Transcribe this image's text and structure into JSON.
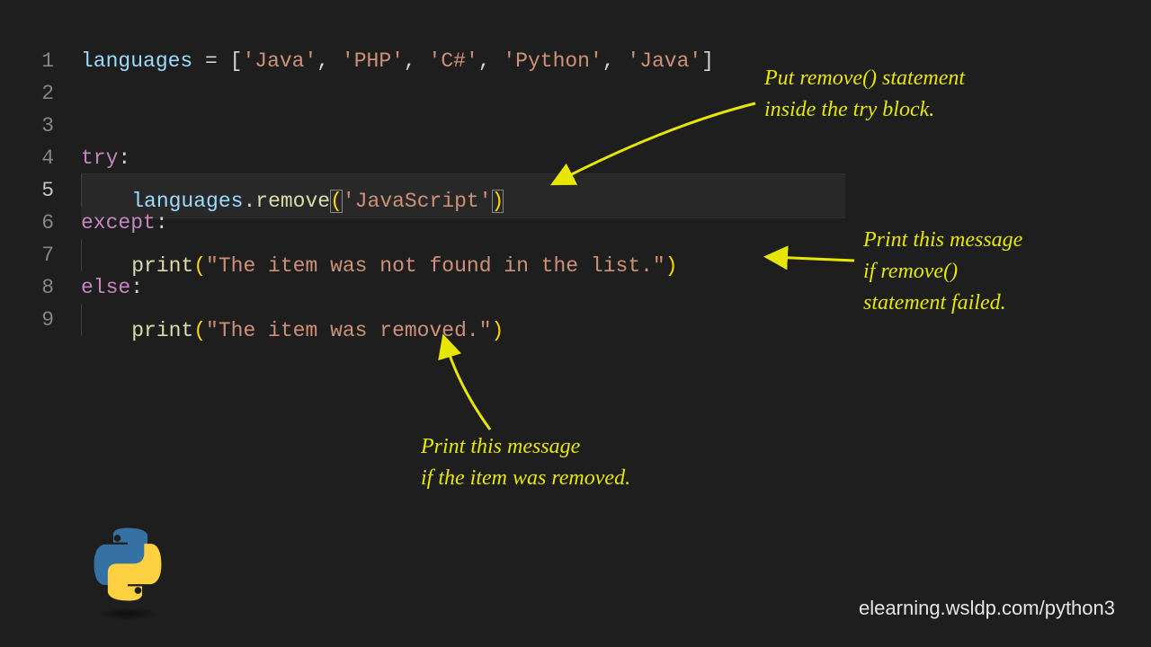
{
  "code": {
    "lines": [
      {
        "num": "1"
      },
      {
        "num": "2"
      },
      {
        "num": "3"
      },
      {
        "num": "4"
      },
      {
        "num": "5"
      },
      {
        "num": "6"
      },
      {
        "num": "7"
      },
      {
        "num": "8"
      },
      {
        "num": "9"
      }
    ],
    "l1": {
      "var": "languages",
      "assign": " = ",
      "lb": "[",
      "s1": "'Java'",
      "c1": ", ",
      "s2": "'PHP'",
      "c2": ", ",
      "s3": "'C#'",
      "c3": ", ",
      "s4": "'Python'",
      "c4": ", ",
      "s5": "'Java'",
      "rb": "]"
    },
    "l4": {
      "kw": "try",
      "colon": ":"
    },
    "l5": {
      "indent": "    ",
      "var": "languages",
      "dot": ".",
      "fn": "remove",
      "lp": "(",
      "arg": "'JavaScript'",
      "rp": ")"
    },
    "l6": {
      "kw": "except",
      "colon": ":"
    },
    "l7": {
      "indent": "    ",
      "fn": "print",
      "lp": "(",
      "arg": "\"The item was not found in the list.\"",
      "rp": ")"
    },
    "l8": {
      "kw": "else",
      "colon": ":"
    },
    "l9": {
      "indent": "    ",
      "fn": "print",
      "lp": "(",
      "arg": "\"The item was removed.\"",
      "rp": ")"
    }
  },
  "annotations": {
    "a1": "Put remove() statement\ninside the try block.",
    "a2": "Print this message\nif remove()\nstatement failed.",
    "a3": "Print this message\nif the item was removed."
  },
  "footer": {
    "url": "elearning.wsldp.com/python3"
  },
  "colors": {
    "annotation": "#e6e600",
    "string": "#ce9178",
    "keyword": "#c586c0",
    "function": "#dcdcaa",
    "identifier": "#9cdcfe"
  }
}
